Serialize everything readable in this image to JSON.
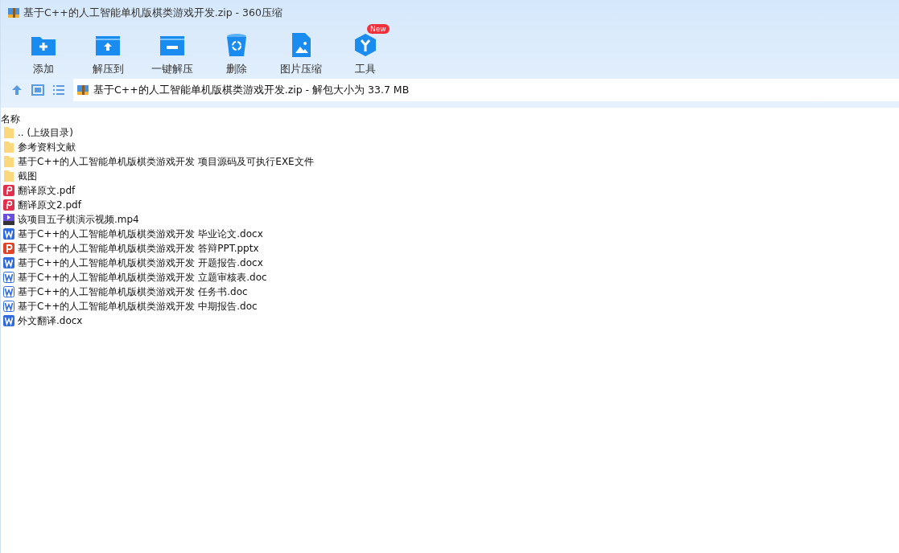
{
  "window": {
    "title": "基于C++的人工智能单机版棋类游戏开发.zip - 360压缩"
  },
  "toolbar": [
    {
      "kind": "add",
      "label": "添加"
    },
    {
      "kind": "extract",
      "label": "解压到"
    },
    {
      "kind": "oneclick",
      "label": "一键解压"
    },
    {
      "kind": "delete",
      "label": "删除"
    },
    {
      "kind": "image",
      "label": "图片压缩"
    },
    {
      "kind": "tools",
      "label": "工具",
      "badge": "New"
    }
  ],
  "path": {
    "text": "基于C++的人工智能单机版棋类游戏开发.zip - 解包大小为 33.7 MB"
  },
  "list": {
    "column": "名称",
    "rows": [
      {
        "kind": "folder",
        "name": ".. (上级目录)"
      },
      {
        "kind": "folder",
        "name": "参考资料文献"
      },
      {
        "kind": "folder",
        "name": "基于C++的人工智能单机版棋类游戏开发 项目源码及可执行EXE文件"
      },
      {
        "kind": "folder",
        "name": "截图"
      },
      {
        "kind": "pdf",
        "name": "翻译原文.pdf"
      },
      {
        "kind": "pdf",
        "name": "翻译原文2.pdf"
      },
      {
        "kind": "video",
        "name": "该项目五子棋演示视频.mp4"
      },
      {
        "kind": "docx",
        "name": "基于C++的人工智能单机版棋类游戏开发 毕业论文.docx"
      },
      {
        "kind": "pptx",
        "name": "基于C++的人工智能单机版棋类游戏开发 答辩PPT.pptx"
      },
      {
        "kind": "docx",
        "name": "基于C++的人工智能单机版棋类游戏开发 开题报告.docx"
      },
      {
        "kind": "doc",
        "name": "基于C++的人工智能单机版棋类游戏开发 立题审核表.doc"
      },
      {
        "kind": "doc",
        "name": "基于C++的人工智能单机版棋类游戏开发 任务书.doc"
      },
      {
        "kind": "doc",
        "name": "基于C++的人工智能单机版棋类游戏开发 中期报告.doc"
      },
      {
        "kind": "docx",
        "name": "外文翻译.docx"
      }
    ]
  }
}
